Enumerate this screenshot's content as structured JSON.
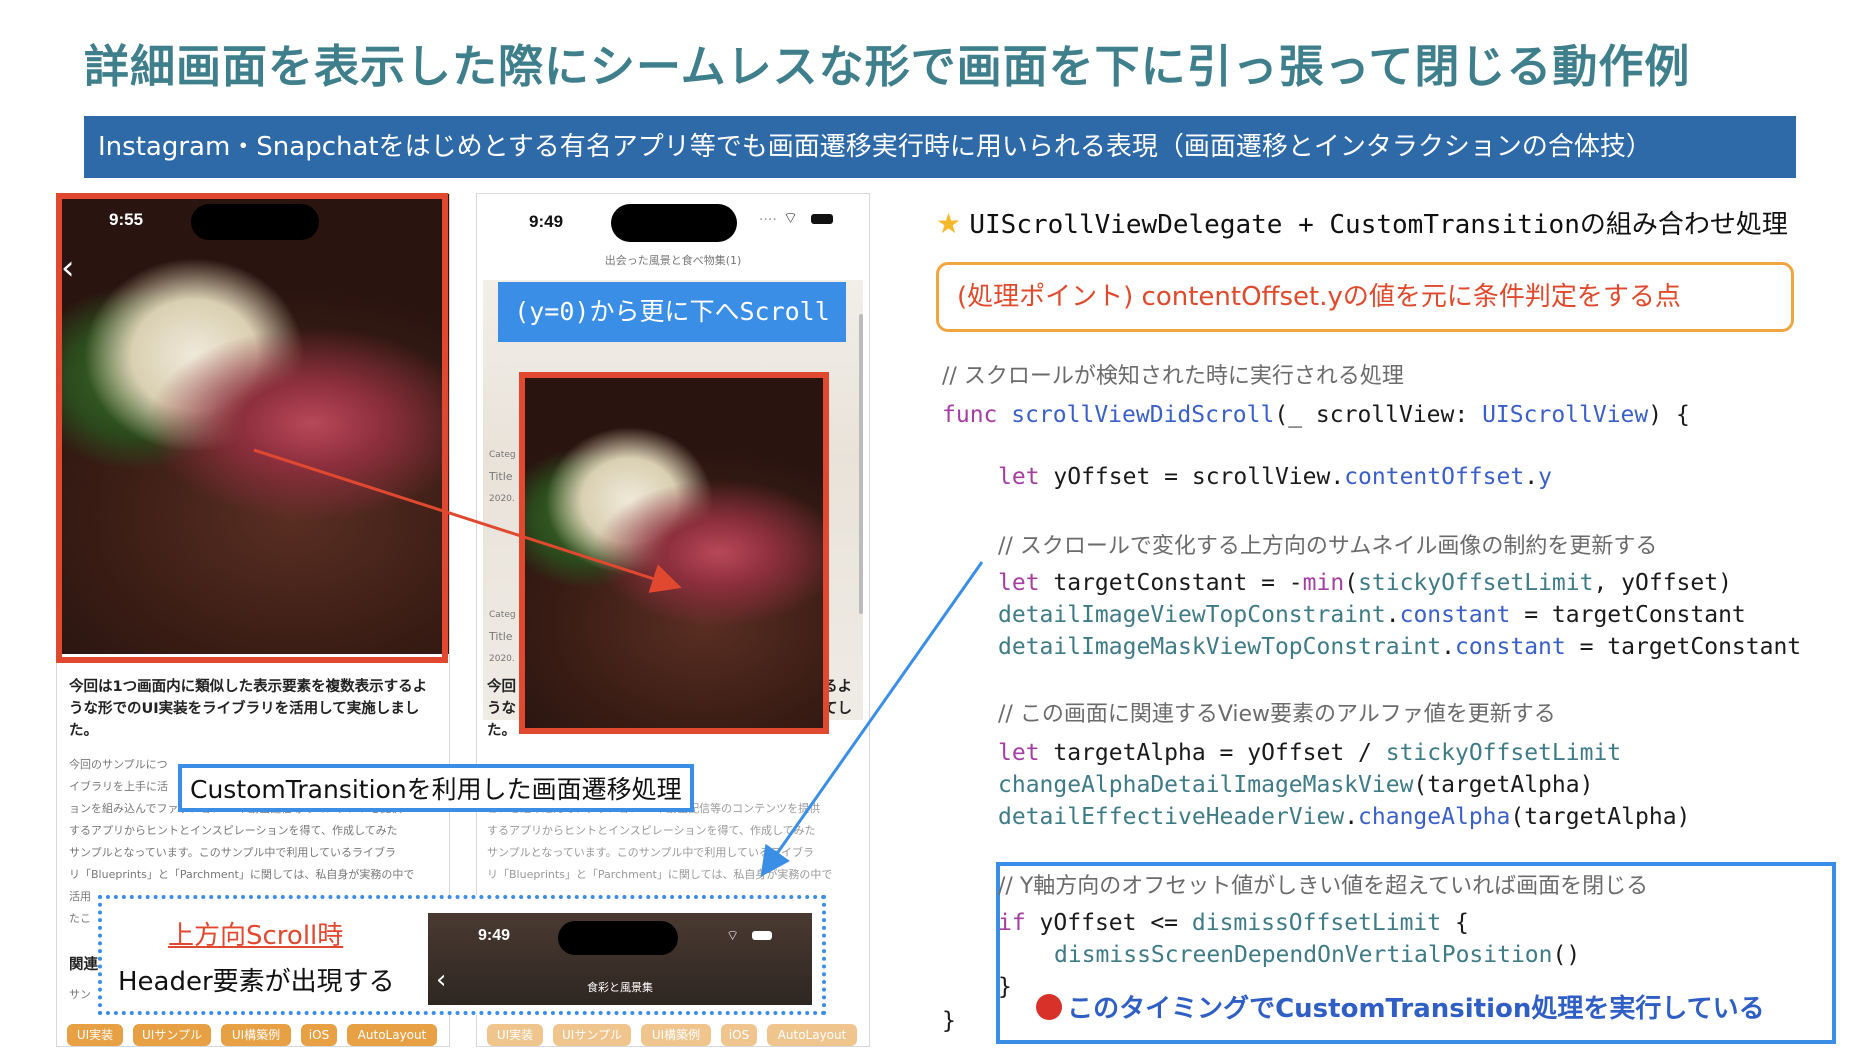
{
  "title": "詳細画面を表示した際にシームレスな形で画面を下に引っ張って閉じる動作例",
  "banner": "Instagram・Snapchatをはじめとする有名アプリ等でも画面遷移実行時に用いられる表現（画面遷移とインタラクションの合体技）",
  "phone1": {
    "time": "9:55",
    "back": "‹",
    "article_title": "今回は1つ画面内に類似した表示要素を複数表示するような形でのUI実装をライブラリを活用して実施しました。",
    "article_lines": [
      "今回のサンプルにつ",
      "イブラリを上手に活",
      "ョンを組み込んでファッションECや動画配信等のコンテンツを提供",
      "するアプリからヒントとインスピレーションを得て、作成してみた",
      "サンプルとなっています。このサンプル中で利用しているライブラ",
      "リ「Blueprints」と「Parchment」に関しては、私自身が実務の中で",
      "活用",
      "たこ"
    ],
    "section": "関連",
    "section_sub": "サン",
    "tags": [
      "UI実装",
      "UIサンプル",
      "UI構築例",
      "iOS",
      "AutoLayout"
    ]
  },
  "phone2": {
    "time": "9:49",
    "nav_title": "出会った風景と食べ物集(1)",
    "scroll_label": "(y=0)から更に下へScroll",
    "bg_labels": [
      "Categ",
      "Title",
      "2020.",
      "Categ",
      "Title",
      "2020."
    ],
    "article_title_frag": [
      "今回",
      "うな",
      "た。",
      "るよ",
      "てし"
    ],
    "article_lines": [
      "イブラリを上手に活",
      "ョンを組み込んでファッションECや動画配信等のコンテンツを提供",
      "するアプリからヒントとインスピレーションを得て、作成してみた",
      "サンプルとなっています。このサンプル中で利用しているライブラ",
      "リ「Blueprints」と「Parchment」に関しては、私自身が実務の中で"
    ],
    "tags": [
      "UI実装",
      "UIサンプル",
      "UI構築例",
      "iOS",
      "AutoLayout"
    ]
  },
  "transition_label": "CustomTransitionを利用した画面遷移処理",
  "header_callout": {
    "line1": "上方向Scroll時",
    "line2": "Header要素が出現する",
    "mini_time": "9:49",
    "mini_title": "食彩と風景集"
  },
  "right": {
    "heading": "UIScrollViewDelegate + CustomTransitionの組み合わせ処理",
    "point": "(処理ポイント) contentOffset.yの値を元に条件判定をする点",
    "comment1": "// スクロールが検知された時に実行される処理",
    "comment2": "// スクロールで変化する上方向のサムネイル画像の制約を更新する",
    "comment3": "// この画面に関連するView要素のアルファ値を更新する",
    "comment4": "// Y軸方向のオフセット値がしきい値を超えていれば画面を閉じる",
    "note": "このタイミングでCustomTransition処理を実行している"
  }
}
